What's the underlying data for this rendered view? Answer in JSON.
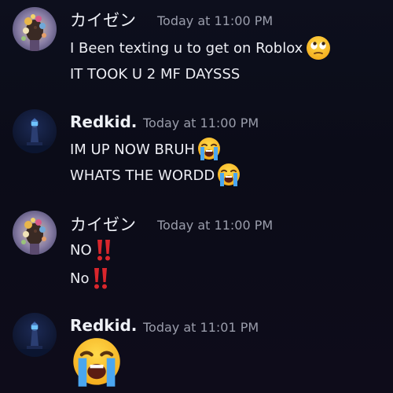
{
  "messages": [
    {
      "username": "カイゼン",
      "timestamp": "Today at 11:00 PM",
      "avatar_icon": "floral-portrait-avatar",
      "lines": [
        {
          "text": "I Been texting u to get on Roblox",
          "emoji": "face-with-rolling-eyes-emoji"
        },
        {
          "text": "IT TOOK U 2 MF DAYSSS",
          "emoji": null
        }
      ]
    },
    {
      "username": "Redkid.",
      "timestamp": "Today at 11:00 PM",
      "avatar_icon": "lighthouse-avatar",
      "lines": [
        {
          "text": "IM UP NOW BRUH",
          "emoji": "loudly-crying-face-emoji"
        },
        {
          "text": "WHATS THE WORDD",
          "emoji": "loudly-crying-face-emoji"
        }
      ]
    },
    {
      "username": "カイゼン",
      "timestamp": "Today at 11:00 PM",
      "avatar_icon": "floral-portrait-avatar",
      "lines": [
        {
          "text": "NO",
          "emoji": "double-exclamation-emoji"
        },
        {
          "text": "No",
          "emoji": "double-exclamation-emoji"
        }
      ]
    },
    {
      "username": "Redkid.",
      "timestamp": "Today at 11:01 PM",
      "avatar_icon": "lighthouse-avatar",
      "lines": [
        {
          "text": "",
          "emoji": "loudly-crying-face-emoji"
        }
      ]
    }
  ],
  "colors": {
    "background": "#0c0d1a",
    "text": "#ecedf3",
    "timestamp": "#9a9dab",
    "exclamation": "#d9262c",
    "emoji_yellow": "#f9c21b",
    "tears_blue": "#4aa6f0"
  }
}
